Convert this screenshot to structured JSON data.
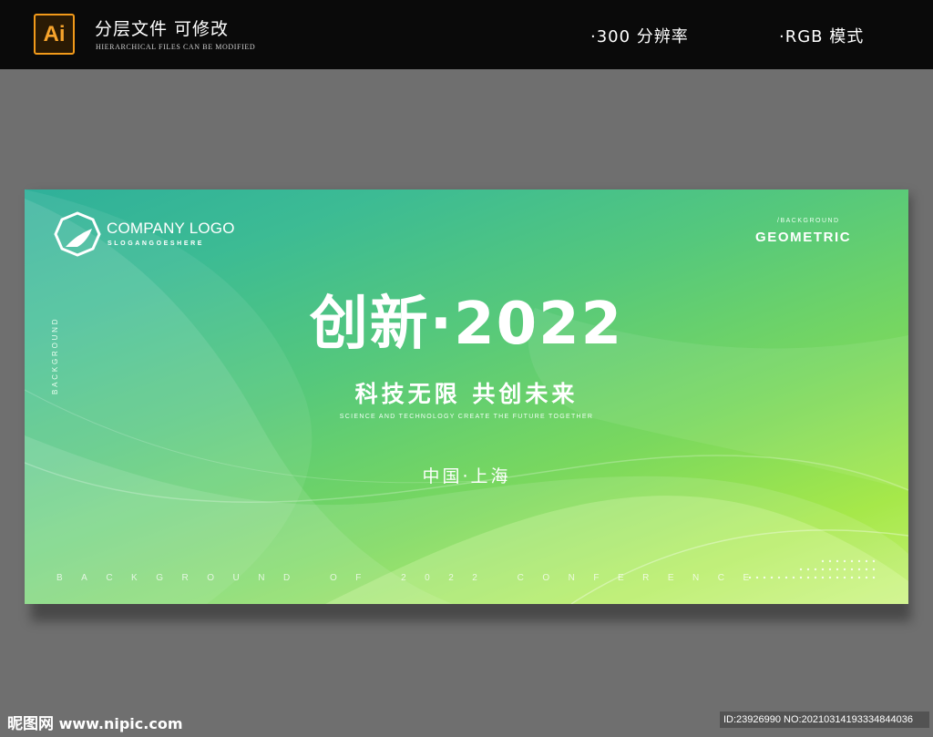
{
  "header": {
    "badge": "Ai",
    "title": "分层文件 可修改",
    "subtitle": "HIERARCHICAL FILES CAN BE MODIFIED",
    "spec_resolution": "·300 分辨率",
    "spec_color_mode": "·RGB 模式"
  },
  "banner": {
    "logo_name": "COMPANY LOGO",
    "logo_slogan": "SLOGANGOESHERE",
    "background_tag": "/BACKGROUND",
    "geometric": "GEOMETRIC",
    "side_text": "BACKGROUND",
    "headline": "创新·2022",
    "subhead": "科技无限 共创未来",
    "subhead_en": "SCIENCE AND TECHNOLOGY CREATE THE FUTURE TOGETHER",
    "location": "中国·上海",
    "bottom_line": "BACKGROUND OF 2022 CONFERENCE"
  },
  "footer": {
    "site_cn": "昵图网",
    "site_url": "www.nipic.com",
    "id_text": "ID:23926990 NO:20210314193334844036"
  },
  "colors": {
    "header_bg": "#0a0a0a",
    "page_bg": "#6f6f6f",
    "ai_orange": "#f29a1a",
    "banner_teal": "#2fb09a",
    "banner_lime": "#c3f071"
  }
}
